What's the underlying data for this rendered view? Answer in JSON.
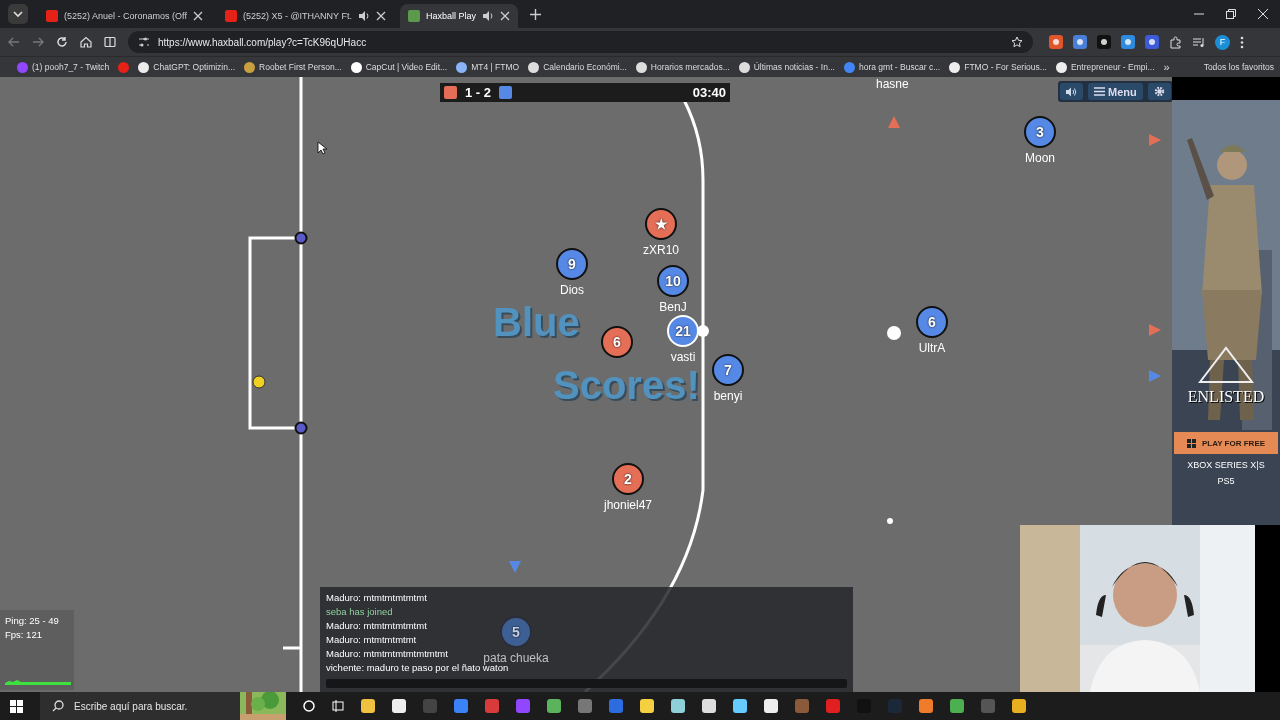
{
  "browser": {
    "tabs": [
      {
        "title": "(5252) Anuel - Coronamos (Off",
        "audio": false,
        "selected": false
      },
      {
        "title": "(5252) X5 - @ITHANNY Ft.",
        "audio": true,
        "selected": false
      },
      {
        "title": "Haxball Play",
        "audio": true,
        "selected": true
      }
    ],
    "url": "https://www.haxball.com/play?c=TcK96qUHacc",
    "bookmarks": [
      {
        "kind": "link",
        "label": "(1) pooh7_7 - Twitch"
      },
      {
        "kind": "icon"
      },
      {
        "kind": "link",
        "label": "ChatGPT: Optimizin..."
      },
      {
        "kind": "link",
        "label": "Roobet First Person..."
      },
      {
        "kind": "link",
        "label": "CapCut | Video Edit..."
      },
      {
        "kind": "link",
        "label": "MT4 | FTMO"
      },
      {
        "kind": "link",
        "label": "Calendario Económi..."
      },
      {
        "kind": "link",
        "label": "Horarios mercados..."
      },
      {
        "kind": "link",
        "label": "Últimas noticias - In..."
      },
      {
        "kind": "link",
        "label": "hora gmt - Buscar c..."
      },
      {
        "kind": "link",
        "label": "FTMO - For Serious..."
      },
      {
        "kind": "link",
        "label": "Entrepreneur - Empi..."
      }
    ],
    "bookmarks_overflow": "»",
    "all_bookmarks": "Todos los favoritos",
    "profile_initial": "F"
  },
  "game": {
    "score": "1 - 2",
    "clock": "03:40",
    "menu_label": "Menu",
    "banner": [
      "Blue",
      "Scores!"
    ],
    "edge_label": "hasne",
    "players": [
      {
        "avatar": "★",
        "name": "zXR10",
        "color": "#e56e56",
        "self": false
      },
      {
        "avatar": "9",
        "name": "Dios",
        "color": "#5689e5",
        "self": false
      },
      {
        "avatar": "10",
        "name": "BenJ",
        "color": "#5689e5",
        "self": false
      },
      {
        "avatar": "6",
        "color": "#e56e56",
        "self": false
      },
      {
        "avatar": "21",
        "name": "vasti",
        "color": "#5689e5",
        "self": true
      },
      {
        "avatar": "7",
        "name": "benyi",
        "color": "#5689e5",
        "self": false
      },
      {
        "avatar": "6",
        "name": "UltrA",
        "color": "#5689e5",
        "self": false
      },
      {
        "avatar": "3",
        "name": "Moon",
        "color": "#5689e5",
        "self": false
      },
      {
        "avatar": "2",
        "name": "jhoniel47",
        "color": "#e56e56",
        "self": false
      },
      {
        "avatar": "5",
        "name": "pata chueka",
        "color": "#3d5f94",
        "self": false
      }
    ],
    "markers": [
      {
        "color": "#e56e56"
      },
      {
        "color": "#e56e56"
      },
      {
        "color": "#e56e56"
      },
      {
        "color": "#5689e5"
      },
      {
        "color": "#5689e5"
      }
    ],
    "stats": {
      "ping": "Ping: 25 - 49",
      "fps": "Fps: 121"
    },
    "chat": [
      {
        "kind": "message",
        "text": "Maduro: mtmtmtmtmtmt"
      },
      {
        "kind": "notice",
        "text": "seba has joined"
      },
      {
        "kind": "message",
        "text": "Maduro: mtmtmtmtmtmt"
      },
      {
        "kind": "message",
        "text": "Maduro: mtmtmtmtmt"
      },
      {
        "kind": "message",
        "text": "Maduro: mtmtmtmtmtmtmtmt"
      },
      {
        "kind": "message",
        "text": "vichente: maduro te paso por el ñato waton"
      }
    ]
  },
  "ad": {
    "title": "ENLISTED",
    "button": "PLAY FOR FREE",
    "platforms": [
      "XBOX SERIES X|S",
      "PS5"
    ]
  },
  "taskbar": {
    "search_placeholder": "Escribe aquí para buscar."
  }
}
